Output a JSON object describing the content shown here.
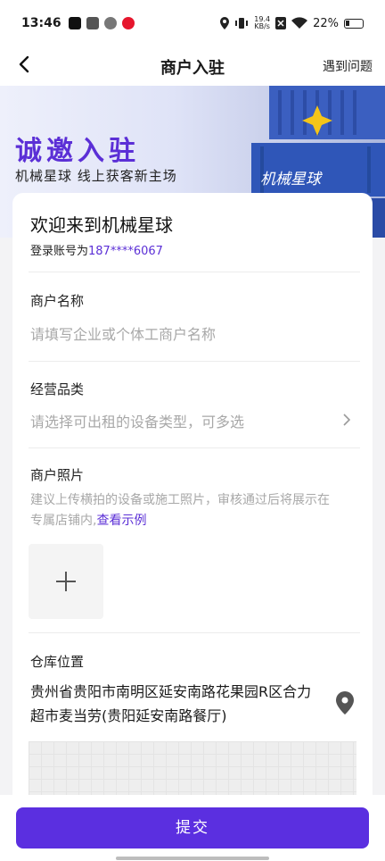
{
  "status_bar": {
    "time": "13:46",
    "net_speed_value": "19.4",
    "net_speed_unit": "KB/s",
    "battery": "22%"
  },
  "header": {
    "title": "商户入驻",
    "help": "遇到问题"
  },
  "banner": {
    "title": "诚邀入驻",
    "subtitle": "机械星球 线上获客新主场",
    "container_logo": "机械星球"
  },
  "form": {
    "welcome": "欢迎来到机械星球",
    "account_prefix": "登录账号为",
    "account_phone": "187****6067",
    "merchant_name_label": "商户名称",
    "merchant_name_placeholder": "请填写企业或个体工商户名称",
    "category_label": "经营品类",
    "category_placeholder": "请选择可出租的设备类型，可多选",
    "photo_label": "商户照片",
    "photo_hint": "建议上传横拍的设备或施工照片，审核通过后将展示在专属店铺内,",
    "photo_example_link": "查看示例",
    "warehouse_label": "仓库位置",
    "warehouse_address": "贵州省贵阳市南明区延安南路花果园R区合力超市麦当劳(贵阳延安南路餐厅)"
  },
  "footer": {
    "submit": "提交"
  },
  "colors": {
    "accent": "#5b2fd6",
    "button": "#5b2fe0"
  }
}
